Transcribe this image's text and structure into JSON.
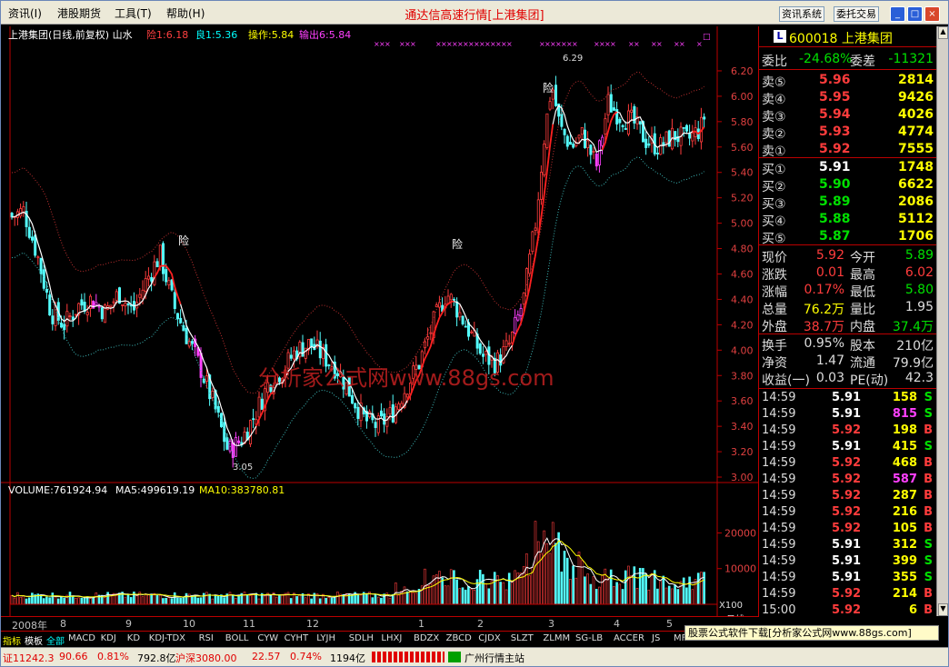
{
  "menu": [
    "资讯(I)",
    "港股期货",
    "工具(T)",
    "帮助(H)"
  ],
  "app_title": "通达信高速行情[上港集团]",
  "top_buttons": [
    "资讯系统",
    "委托交易"
  ],
  "window_buttons": [
    "_",
    "□",
    "×"
  ],
  "chart_header": {
    "name": "上港集团(日线,前复权) 山水",
    "risk": "险1:6.18",
    "good": "良1:5.36",
    "operate": "操作:5.84",
    "output": "输出6:5.84"
  },
  "volume_header": {
    "volume": "VOLUME:761924.94",
    "ma5": "MA5:499619.19",
    "ma10": "MA10:383780.81"
  },
  "annotations": {
    "high": "6.29",
    "low": "3.05",
    "risk_label": "险"
  },
  "watermark": "分析家公式网www.88gs.com",
  "price_axis": [
    "6.20",
    "6.00",
    "5.80",
    "5.60",
    "5.40",
    "5.20",
    "5.00",
    "4.80",
    "4.60",
    "4.40",
    "4.20",
    "4.00",
    "3.80",
    "3.60",
    "3.40",
    "3.20",
    "3.00"
  ],
  "volume_axis": [
    "20000",
    "10000"
  ],
  "volume_unit": "X100",
  "period_label": "日线",
  "month_labels": [
    "2008年",
    "8",
    "9",
    "10",
    "11",
    "12",
    "1",
    "2",
    "3",
    "4",
    "5",
    "6"
  ],
  "tabs": [
    "指标",
    "模板",
    "全部",
    "MACD",
    "KDJ",
    "KD",
    "KDJ-TDX",
    "RSI",
    "BOLL",
    "CYW",
    "CYHT",
    "LYJH",
    "SDLH",
    "LHXJ",
    "BDZX",
    "ZBCD",
    "CJDX",
    "SLZT",
    "ZLMM",
    "SG-LB",
    "ACCER",
    "JS",
    "MFI"
  ],
  "ad_text": "股票公式软件下载[分析家公式网www.88gs.com]",
  "stock": {
    "badge": "L",
    "code_name": "600018 上港集团"
  },
  "order_ratio": {
    "label1": "委比",
    "value1": "-24.68%",
    "label2": "委差",
    "value2": "-11321"
  },
  "asks": [
    {
      "label": "卖⑤",
      "price": "5.96",
      "vol": "2814"
    },
    {
      "label": "卖④",
      "price": "5.95",
      "vol": "9426"
    },
    {
      "label": "卖③",
      "price": "5.94",
      "vol": "4026"
    },
    {
      "label": "卖②",
      "price": "5.93",
      "vol": "4774"
    },
    {
      "label": "卖①",
      "price": "5.92",
      "vol": "7555"
    }
  ],
  "bids": [
    {
      "label": "买①",
      "price": "5.91",
      "vol": "1748"
    },
    {
      "label": "买②",
      "price": "5.90",
      "vol": "6622"
    },
    {
      "label": "买③",
      "price": "5.89",
      "vol": "2086"
    },
    {
      "label": "买④",
      "price": "5.88",
      "vol": "5112"
    },
    {
      "label": "买⑤",
      "price": "5.87",
      "vol": "1706"
    }
  ],
  "stats": [
    {
      "l1": "现价",
      "v1": "5.92",
      "l2": "今开",
      "v2": "5.89"
    },
    {
      "l1": "涨跌",
      "v1": "0.01",
      "l2": "最高",
      "v2": "6.02"
    },
    {
      "l1": "涨幅",
      "v1": "0.17%",
      "l2": "最低",
      "v2": "5.80"
    },
    {
      "l1": "总量",
      "v1": "76.2万",
      "l2": "量比",
      "v2": "1.95"
    },
    {
      "l1": "外盘",
      "v1": "38.7万",
      "l2": "内盘",
      "v2": "37.4万"
    }
  ],
  "fin": [
    {
      "l1": "换手",
      "v1": "0.95%",
      "l2": "股本",
      "v2": "210亿"
    },
    {
      "l1": "净资",
      "v1": "1.47",
      "l2": "流通",
      "v2": "79.9亿"
    },
    {
      "l1": "收益(一)",
      "v1": "0.03",
      "l2": "PE(动)",
      "v2": "42.3"
    }
  ],
  "ticks": [
    {
      "t": "14:59",
      "p": "5.91",
      "v": "158",
      "d": "S"
    },
    {
      "t": "14:59",
      "p": "5.91",
      "v": "815",
      "d": "S"
    },
    {
      "t": "14:59",
      "p": "5.92",
      "v": "198",
      "d": "B"
    },
    {
      "t": "14:59",
      "p": "5.91",
      "v": "415",
      "d": "S"
    },
    {
      "t": "14:59",
      "p": "5.92",
      "v": "468",
      "d": "B"
    },
    {
      "t": "14:59",
      "p": "5.92",
      "v": "587",
      "d": "B"
    },
    {
      "t": "14:59",
      "p": "5.92",
      "v": "287",
      "d": "B"
    },
    {
      "t": "14:59",
      "p": "5.92",
      "v": "216",
      "d": "B"
    },
    {
      "t": "14:59",
      "p": "5.92",
      "v": "105",
      "d": "B"
    },
    {
      "t": "14:59",
      "p": "5.91",
      "v": "312",
      "d": "S"
    },
    {
      "t": "14:59",
      "p": "5.91",
      "v": "399",
      "d": "S"
    },
    {
      "t": "14:59",
      "p": "5.91",
      "v": "355",
      "d": "S"
    },
    {
      "t": "14:59",
      "p": "5.92",
      "v": "214",
      "d": "B"
    },
    {
      "t": "15:00",
      "p": "5.92",
      "v": "6",
      "d": "B"
    }
  ],
  "status": {
    "idx1": "证11242.3",
    "chg1": "90.66",
    "pct1": "0.81%",
    "amt1": "792.8亿",
    "idx2": "沪深3080.00",
    "chg2": "22.57",
    "pct2": "0.74%",
    "amt2": "1194亿",
    "server": "广州行情主站"
  },
  "colors": {
    "up": "#ff3c3c",
    "down": "#00ffff",
    "flat": "#ffffff",
    "green": "#00e000",
    "yellow": "#ffff00",
    "magenta": "#ff40ff"
  }
}
